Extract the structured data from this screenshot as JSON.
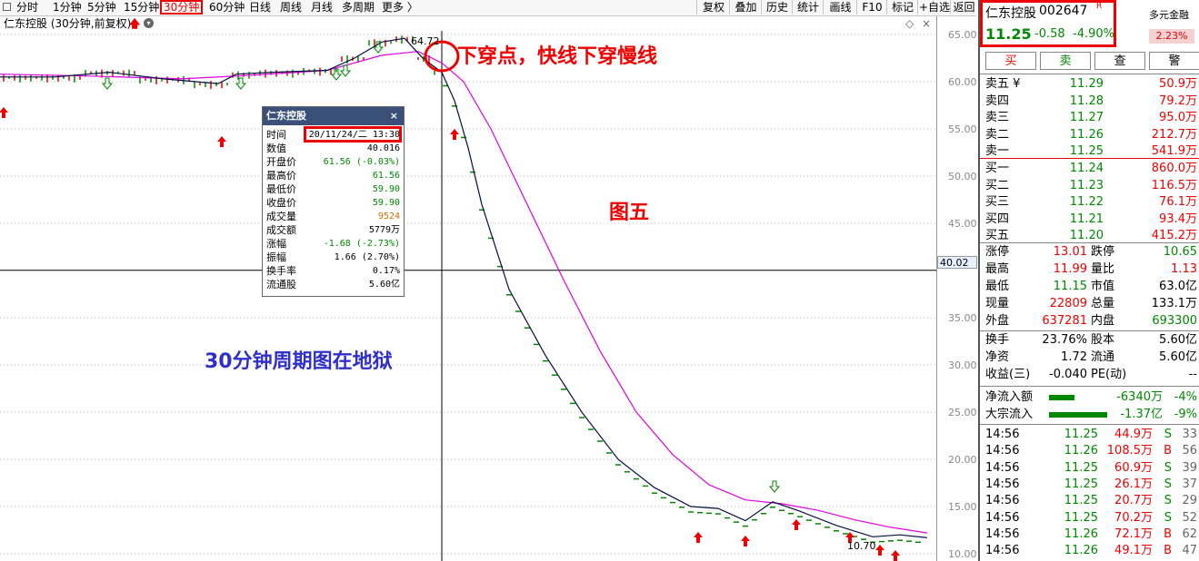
{
  "toolbar": {
    "periods": [
      "分时",
      "1分钟",
      "5分钟",
      "15分钟",
      "30分钟",
      "60分钟",
      "日线",
      "周线",
      "月线",
      "多周期",
      "更多 〉"
    ],
    "active_period": "30分钟",
    "right_buttons": [
      "复权",
      "叠加",
      "历史",
      "统计",
      "画线",
      "F10",
      "标记",
      "+自选",
      "返回"
    ]
  },
  "subheader": {
    "title": "仁东控股 (30分钟,前复权)"
  },
  "chart": {
    "y_ticks": [
      "65.00",
      "60.00",
      "55.00",
      "50.00",
      "45.00",
      "40.00",
      "35.00",
      "30.00",
      "25.00",
      "20.00",
      "15.00",
      "10.00"
    ],
    "current_price_label": "40.02",
    "high_label": "64.72",
    "low_label": "10.70",
    "fast_line_color": "#001040",
    "slow_line_color": "#e000e0"
  },
  "tooltip": {
    "title": "仁东控股",
    "rows": [
      {
        "k": "时间",
        "v": "20/11/24/二 13:30",
        "color": "#000"
      },
      {
        "k": "数值",
        "v": "40.016",
        "color": "#000"
      },
      {
        "k": "开盘价",
        "v": "61.56 (-0.03%)",
        "color": "#080"
      },
      {
        "k": "最高价",
        "v": "61.56",
        "color": "#080"
      },
      {
        "k": "最低价",
        "v": "59.90",
        "color": "#080"
      },
      {
        "k": "收盘价",
        "v": "59.90",
        "color": "#080"
      },
      {
        "k": "成交量",
        "v": "9524",
        "color": "#d07000"
      },
      {
        "k": "成交额",
        "v": "5779万",
        "color": "#000"
      },
      {
        "k": "涨幅",
        "v": "-1.68 (-2.73%)",
        "color": "#080"
      },
      {
        "k": "振幅",
        "v": "1.66 (2.70%)",
        "color": "#000"
      },
      {
        "k": "换手率",
        "v": "0.17%",
        "color": "#000"
      },
      {
        "k": "流通股",
        "v": "5.60亿",
        "color": "#000"
      }
    ]
  },
  "annotations": {
    "cross": "下穿点，快线下穿慢线",
    "figure": "图五",
    "caption": "30分钟周期图在地狱"
  },
  "quote": {
    "name": "仁东控股",
    "code": "002647",
    "flag": "R",
    "price": "11.25",
    "change": "-0.58",
    "pct": "-4.90%",
    "tag": "多元金融",
    "tag_pct": "2.23%",
    "buttons": [
      "买",
      "卖",
      "查",
      "警"
    ],
    "asks": [
      {
        "label": "卖五 ¥",
        "price": "11.29",
        "vol": "50.9万"
      },
      {
        "label": "卖四",
        "price": "11.28",
        "vol": "79.2万"
      },
      {
        "label": "卖三",
        "price": "11.27",
        "vol": "95.0万"
      },
      {
        "label": "卖二",
        "price": "11.26",
        "vol": "212.7万"
      },
      {
        "label": "卖一",
        "price": "11.25",
        "vol": "541.9万"
      }
    ],
    "bids": [
      {
        "label": "买一",
        "price": "11.24",
        "vol": "860.0万"
      },
      {
        "label": "买二",
        "price": "11.23",
        "vol": "116.5万"
      },
      {
        "label": "买三",
        "price": "11.22",
        "vol": "76.1万"
      },
      {
        "label": "买四",
        "price": "11.21",
        "vol": "93.4万"
      },
      {
        "label": "买五",
        "price": "11.20",
        "vol": "415.2万"
      }
    ],
    "stats1": [
      {
        "k1": "涨停",
        "v1": "13.01",
        "c1": "red",
        "k2": "跌停",
        "v2": "10.65",
        "c2": "green"
      },
      {
        "k1": "最高",
        "v1": "11.99",
        "c1": "red",
        "k2": "量比",
        "v2": "1.13",
        "c2": "red"
      },
      {
        "k1": "最低",
        "v1": "11.15",
        "c1": "green",
        "k2": "市值",
        "v2": "63.0亿",
        "c2": "black"
      },
      {
        "k1": "现量",
        "v1": "22809",
        "c1": "red",
        "k2": "总量",
        "v2": "133.1万",
        "c2": "black"
      },
      {
        "k1": "外盘",
        "v1": "637281",
        "c1": "red",
        "k2": "内盘",
        "v2": "693300",
        "c2": "green"
      }
    ],
    "stats2": [
      {
        "k1": "换手",
        "v1": "23.76%",
        "c1": "black",
        "k2": "股本",
        "v2": "5.60亿",
        "c2": "black"
      },
      {
        "k1": "净资",
        "v1": "1.72",
        "c1": "black",
        "k2": "流通",
        "v2": "5.60亿",
        "c2": "black"
      },
      {
        "k1": "收益(三)",
        "v1": "-0.040",
        "c1": "black",
        "k2": "PE(动)",
        "v2": "--",
        "c2": "black"
      }
    ],
    "flows": [
      {
        "k": "净流入额",
        "v": "-6340万",
        "p": "-4%",
        "bar": 0.35
      },
      {
        "k": "大宗流入",
        "v": "-1.37亿",
        "p": "-9%",
        "bar": 0.8
      }
    ],
    "ticks": [
      {
        "t": "14:56",
        "p": "11.25",
        "v": "44.9万",
        "d": "S",
        "n": "33"
      },
      {
        "t": "14:56",
        "p": "11.26",
        "v": "108.5万",
        "d": "B",
        "n": "56"
      },
      {
        "t": "14:56",
        "p": "11.25",
        "v": "60.9万",
        "d": "S",
        "n": "39"
      },
      {
        "t": "14:56",
        "p": "11.25",
        "v": "26.1万",
        "d": "S",
        "n": "37"
      },
      {
        "t": "14:56",
        "p": "11.25",
        "v": "20.7万",
        "d": "S",
        "n": "29"
      },
      {
        "t": "14:56",
        "p": "11.25",
        "v": "70.2万",
        "d": "S",
        "n": "52"
      },
      {
        "t": "14:56",
        "p": "11.26",
        "v": "72.1万",
        "d": "B",
        "n": "62"
      },
      {
        "t": "14:56",
        "p": "11.26",
        "v": "49.1万",
        "d": "B",
        "n": "47"
      }
    ]
  }
}
